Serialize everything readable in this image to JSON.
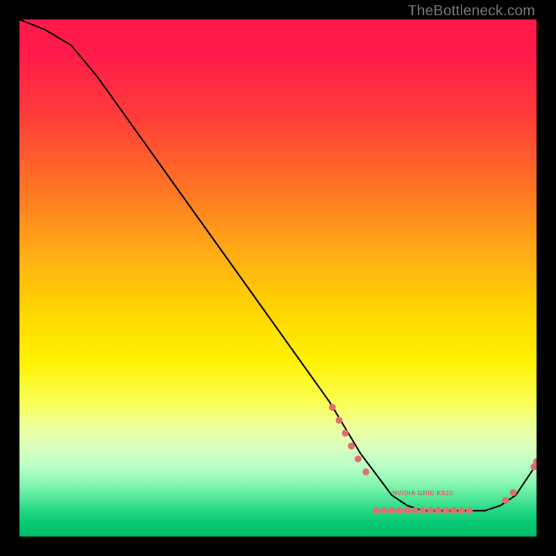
{
  "attribution": "TheBottleneck.com",
  "chart_data": {
    "type": "line",
    "title": "",
    "xlabel": "",
    "ylabel": "",
    "x_range": [
      0,
      100
    ],
    "y_range": [
      0,
      100
    ],
    "series": [
      {
        "name": "curve",
        "color": "#000000",
        "x": [
          0,
          5,
          10,
          15,
          20,
          25,
          30,
          35,
          40,
          45,
          50,
          55,
          60,
          63,
          66,
          69,
          72,
          75,
          78,
          81,
          84,
          87,
          90,
          93,
          96,
          100
        ],
        "y": [
          100,
          98,
          95,
          89,
          82,
          75,
          68,
          61,
          54,
          47,
          40,
          33,
          26,
          21,
          16,
          12,
          8,
          6,
          5,
          5,
          5,
          5,
          5,
          6,
          8,
          14
        ]
      }
    ],
    "markers": [
      {
        "x": 60.5,
        "y": 25.0,
        "color": "#e26d6d"
      },
      {
        "x": 61.8,
        "y": 22.5,
        "color": "#e26d6d"
      },
      {
        "x": 63.0,
        "y": 20.0,
        "color": "#e26d6d"
      },
      {
        "x": 64.2,
        "y": 17.5,
        "color": "#e26d6d"
      },
      {
        "x": 65.5,
        "y": 15.0,
        "color": "#e26d6d"
      },
      {
        "x": 67.0,
        "y": 12.5,
        "color": "#e26d6d"
      },
      {
        "x": 69.0,
        "y": 5.0,
        "color": "#e26d6d"
      },
      {
        "x": 70.5,
        "y": 5.0,
        "color": "#e26d6d"
      },
      {
        "x": 72.0,
        "y": 5.0,
        "color": "#e26d6d"
      },
      {
        "x": 73.5,
        "y": 5.0,
        "color": "#e26d6d"
      },
      {
        "x": 75.0,
        "y": 5.0,
        "color": "#e26d6d"
      },
      {
        "x": 76.5,
        "y": 5.0,
        "color": "#e26d6d"
      },
      {
        "x": 78.0,
        "y": 5.0,
        "color": "#e26d6d"
      },
      {
        "x": 79.5,
        "y": 5.0,
        "color": "#e26d6d"
      },
      {
        "x": 81.0,
        "y": 5.0,
        "color": "#e26d6d"
      },
      {
        "x": 82.5,
        "y": 5.0,
        "color": "#e26d6d"
      },
      {
        "x": 84.0,
        "y": 5.0,
        "color": "#e26d6d"
      },
      {
        "x": 85.5,
        "y": 5.0,
        "color": "#e26d6d"
      },
      {
        "x": 87.0,
        "y": 5.0,
        "color": "#e26d6d"
      },
      {
        "x": 94.0,
        "y": 7.0,
        "color": "#e26d6d"
      },
      {
        "x": 95.5,
        "y": 8.5,
        "color": "#e26d6d"
      },
      {
        "x": 99.5,
        "y": 13.5,
        "color": "#e26d6d"
      },
      {
        "x": 100.0,
        "y": 14.5,
        "color": "#e26d6d"
      }
    ],
    "marker_label": "NVIDIA GRID K520",
    "marker_label_pos": {
      "x": 78,
      "y": 8
    },
    "gradient_stops": [
      {
        "pos": 0.0,
        "color": "#ff1a4b"
      },
      {
        "pos": 0.5,
        "color": "#ffd400"
      },
      {
        "pos": 0.8,
        "color": "#f0ff90"
      },
      {
        "pos": 1.0,
        "color": "#00be6b"
      }
    ]
  }
}
